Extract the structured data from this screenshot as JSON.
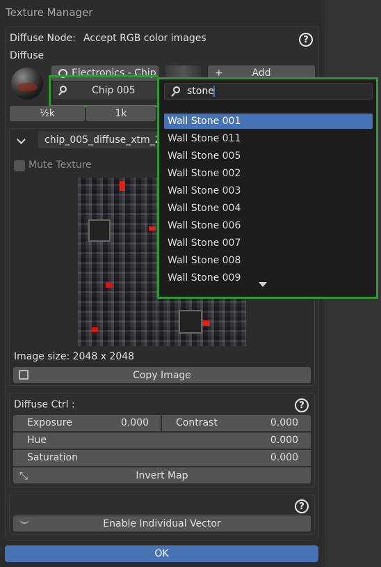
{
  "window": {
    "title": "Texture Manager"
  },
  "diffuse_node": {
    "label": "Diffuse Node:",
    "value": "Accept RGB color images"
  },
  "diffuse": {
    "label": "Diffuse"
  },
  "category_button": {
    "label": "Electronics - Chip"
  },
  "add_button": {
    "label": "Add",
    "plus": "+"
  },
  "texture_button": {
    "label": "Chip 005"
  },
  "resolutions": [
    "½k",
    "1k"
  ],
  "file_field": {
    "value": "chip_005_diffuse_xtm_2"
  },
  "mute": {
    "label": "Mute Texture"
  },
  "image_info": {
    "size_label": "Image size: 2048 x 2048"
  },
  "copy_image": {
    "label": "Copy Image"
  },
  "diffuse_ctrl": {
    "title": "Diffuse Ctrl :",
    "exposure": {
      "label": "Exposure",
      "value": "0.000"
    },
    "contrast": {
      "label": "Contrast",
      "value": "0.000"
    },
    "hue": {
      "label": "Hue",
      "value": "0.000"
    },
    "saturation": {
      "label": "Saturation",
      "value": "0.000"
    },
    "invert_map": "Invert Map"
  },
  "vector": {
    "enable_label": "Enable Individual Vector"
  },
  "ok": {
    "label": "OK"
  },
  "search": {
    "value": "stone"
  },
  "dropdown": {
    "items": [
      "Wall Stone 001",
      "Wall Stone 011",
      "Wall Stone 005",
      "Wall Stone 002",
      "Wall Stone 003",
      "Wall Stone 004",
      "Wall Stone 006",
      "Wall Stone 007",
      "Wall Stone 008",
      "Wall Stone 009"
    ],
    "selected_index": 0
  },
  "colors": {
    "accent": "#4772b3",
    "highlight": "#2d9a33"
  }
}
